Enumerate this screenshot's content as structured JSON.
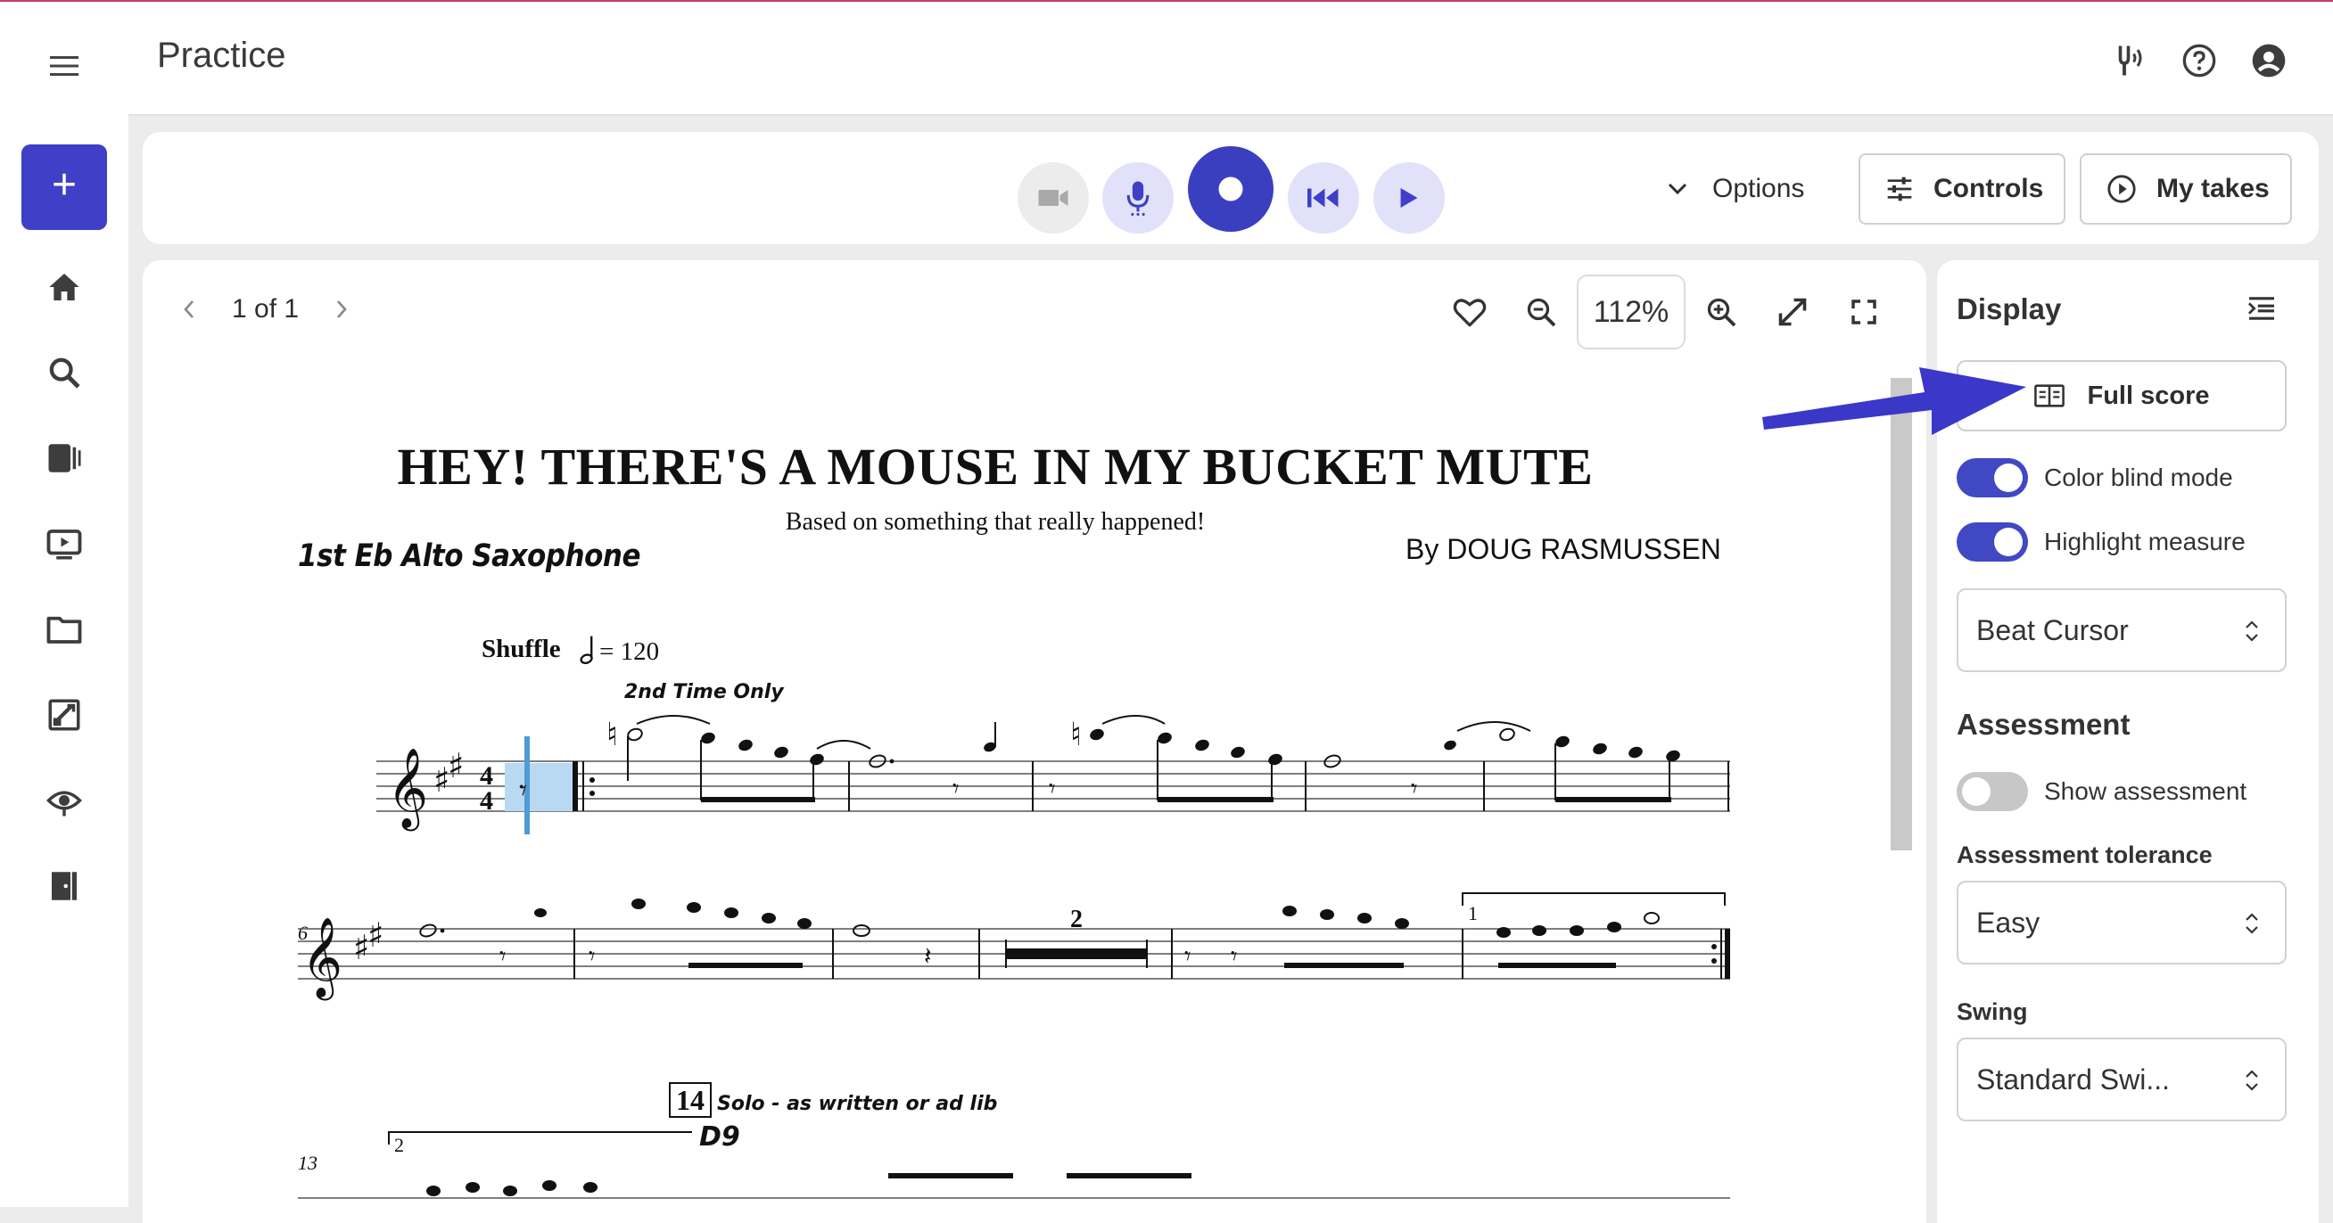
{
  "app": {
    "title": "Practice"
  },
  "top_icons": [
    "tuner-icon",
    "help-icon",
    "account-icon"
  ],
  "nav": {
    "new_label": "+",
    "items": [
      "home-icon",
      "search-icon",
      "library-icon",
      "video-icon",
      "folder-icon",
      "assignment-icon",
      "ear-training-icon",
      "exit-icon"
    ]
  },
  "toolbar": {
    "options_label": "Options",
    "controls_label": "Controls",
    "my_takes_label": "My takes"
  },
  "viewer": {
    "page_indicator": "1 of 1",
    "zoom": "112%"
  },
  "score": {
    "title": "HEY! THERE'S A MOUSE IN MY BUCKET MUTE",
    "subtitle": "Based on something that really happened!",
    "instrument": "1st Eb Alto Saxophone",
    "composer": "By DOUG RASMUSSEN",
    "style": "Shuffle",
    "tempo": "= 120",
    "second_time": "2nd Time Only",
    "solo_text": "Solo - as written or ad lib",
    "rehearsal_mark": "14",
    "chord": "D9",
    "measure_numbers": [
      "6",
      "13"
    ],
    "multirest": "2",
    "ending": "1",
    "ending2": "2"
  },
  "sidebar": {
    "display_title": "Display",
    "full_score_label": "Full score",
    "color_blind_label": "Color blind mode",
    "color_blind_on": true,
    "highlight_label": "Highlight measure",
    "highlight_on": true,
    "cursor_select": "Beat Cursor",
    "assessment_title": "Assessment",
    "show_assessment_label": "Show assessment",
    "show_assessment_on": false,
    "tolerance_label": "Assessment tolerance",
    "tolerance_value": "Easy",
    "swing_label": "Swing",
    "swing_value": "Standard Swi..."
  },
  "colors": {
    "accent": "#3f3fc8",
    "accent_light": "#e1e2fa",
    "annotation_arrow": "#3a37c9",
    "measure_highlight": "#b9d9f2"
  }
}
